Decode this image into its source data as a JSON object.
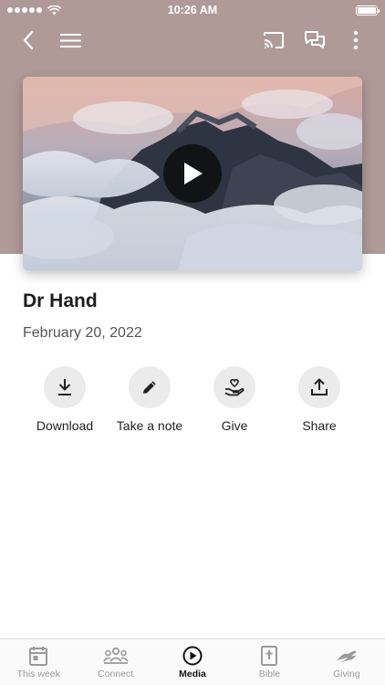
{
  "status_bar": {
    "time": "10:26 AM"
  },
  "nav": {
    "back_icon": "chevron-left-icon",
    "menu_icon": "hamburger-menu-icon",
    "cast_icon": "cast-icon",
    "chat_icon": "chat-icon",
    "more_icon": "more-vertical-icon"
  },
  "media": {
    "title": "Dr Hand",
    "date": "February 20, 2022",
    "thumbnail": "mountain peaks above clouds",
    "play_icon": "play-icon"
  },
  "actions": [
    {
      "label": "Download",
      "icon": "download-icon"
    },
    {
      "label": "Take a note",
      "icon": "pencil-icon"
    },
    {
      "label": "Give",
      "icon": "give-heart-hand-icon"
    },
    {
      "label": "Share",
      "icon": "share-upload-icon"
    }
  ],
  "tabs": [
    {
      "label": "This week",
      "icon": "calendar-icon",
      "active": false
    },
    {
      "label": "Connect",
      "icon": "people-group-icon",
      "active": false
    },
    {
      "label": "Media",
      "icon": "play-circle-icon",
      "active": true
    },
    {
      "label": "Bible",
      "icon": "bible-icon",
      "active": false
    },
    {
      "label": "Giving",
      "icon": "hand-giving-icon",
      "active": false
    }
  ],
  "colors": {
    "header_background": "#b09a98",
    "active_tab": "#111111",
    "inactive_tab": "#9a9a9a",
    "action_circle": "#ebebeb"
  }
}
